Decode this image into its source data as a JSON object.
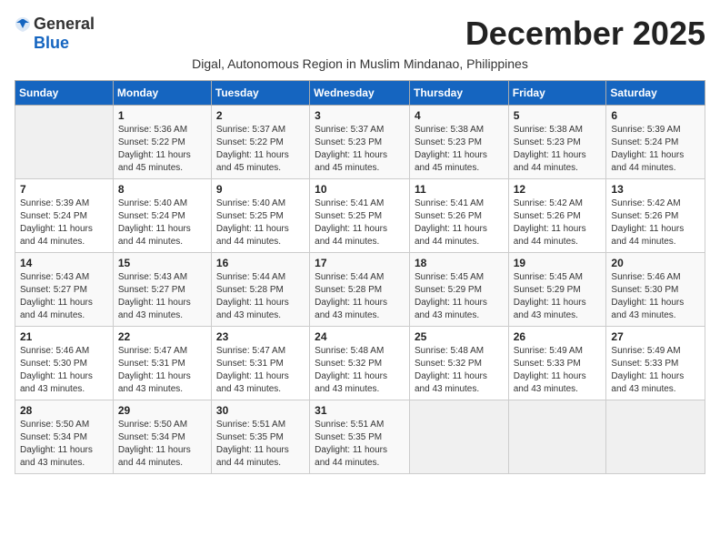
{
  "header": {
    "logo_line1": "General",
    "logo_line2": "Blue",
    "month_year": "December 2025",
    "subtitle": "Digal, Autonomous Region in Muslim Mindanao, Philippines"
  },
  "columns": [
    "Sunday",
    "Monday",
    "Tuesday",
    "Wednesday",
    "Thursday",
    "Friday",
    "Saturday"
  ],
  "weeks": [
    [
      {
        "day": "",
        "info": ""
      },
      {
        "day": "1",
        "info": "Sunrise: 5:36 AM\nSunset: 5:22 PM\nDaylight: 11 hours\nand 45 minutes."
      },
      {
        "day": "2",
        "info": "Sunrise: 5:37 AM\nSunset: 5:22 PM\nDaylight: 11 hours\nand 45 minutes."
      },
      {
        "day": "3",
        "info": "Sunrise: 5:37 AM\nSunset: 5:23 PM\nDaylight: 11 hours\nand 45 minutes."
      },
      {
        "day": "4",
        "info": "Sunrise: 5:38 AM\nSunset: 5:23 PM\nDaylight: 11 hours\nand 45 minutes."
      },
      {
        "day": "5",
        "info": "Sunrise: 5:38 AM\nSunset: 5:23 PM\nDaylight: 11 hours\nand 44 minutes."
      },
      {
        "day": "6",
        "info": "Sunrise: 5:39 AM\nSunset: 5:24 PM\nDaylight: 11 hours\nand 44 minutes."
      }
    ],
    [
      {
        "day": "7",
        "info": "Sunrise: 5:39 AM\nSunset: 5:24 PM\nDaylight: 11 hours\nand 44 minutes."
      },
      {
        "day": "8",
        "info": "Sunrise: 5:40 AM\nSunset: 5:24 PM\nDaylight: 11 hours\nand 44 minutes."
      },
      {
        "day": "9",
        "info": "Sunrise: 5:40 AM\nSunset: 5:25 PM\nDaylight: 11 hours\nand 44 minutes."
      },
      {
        "day": "10",
        "info": "Sunrise: 5:41 AM\nSunset: 5:25 PM\nDaylight: 11 hours\nand 44 minutes."
      },
      {
        "day": "11",
        "info": "Sunrise: 5:41 AM\nSunset: 5:26 PM\nDaylight: 11 hours\nand 44 minutes."
      },
      {
        "day": "12",
        "info": "Sunrise: 5:42 AM\nSunset: 5:26 PM\nDaylight: 11 hours\nand 44 minutes."
      },
      {
        "day": "13",
        "info": "Sunrise: 5:42 AM\nSunset: 5:26 PM\nDaylight: 11 hours\nand 44 minutes."
      }
    ],
    [
      {
        "day": "14",
        "info": "Sunrise: 5:43 AM\nSunset: 5:27 PM\nDaylight: 11 hours\nand 44 minutes."
      },
      {
        "day": "15",
        "info": "Sunrise: 5:43 AM\nSunset: 5:27 PM\nDaylight: 11 hours\nand 43 minutes."
      },
      {
        "day": "16",
        "info": "Sunrise: 5:44 AM\nSunset: 5:28 PM\nDaylight: 11 hours\nand 43 minutes."
      },
      {
        "day": "17",
        "info": "Sunrise: 5:44 AM\nSunset: 5:28 PM\nDaylight: 11 hours\nand 43 minutes."
      },
      {
        "day": "18",
        "info": "Sunrise: 5:45 AM\nSunset: 5:29 PM\nDaylight: 11 hours\nand 43 minutes."
      },
      {
        "day": "19",
        "info": "Sunrise: 5:45 AM\nSunset: 5:29 PM\nDaylight: 11 hours\nand 43 minutes."
      },
      {
        "day": "20",
        "info": "Sunrise: 5:46 AM\nSunset: 5:30 PM\nDaylight: 11 hours\nand 43 minutes."
      }
    ],
    [
      {
        "day": "21",
        "info": "Sunrise: 5:46 AM\nSunset: 5:30 PM\nDaylight: 11 hours\nand 43 minutes."
      },
      {
        "day": "22",
        "info": "Sunrise: 5:47 AM\nSunset: 5:31 PM\nDaylight: 11 hours\nand 43 minutes."
      },
      {
        "day": "23",
        "info": "Sunrise: 5:47 AM\nSunset: 5:31 PM\nDaylight: 11 hours\nand 43 minutes."
      },
      {
        "day": "24",
        "info": "Sunrise: 5:48 AM\nSunset: 5:32 PM\nDaylight: 11 hours\nand 43 minutes."
      },
      {
        "day": "25",
        "info": "Sunrise: 5:48 AM\nSunset: 5:32 PM\nDaylight: 11 hours\nand 43 minutes."
      },
      {
        "day": "26",
        "info": "Sunrise: 5:49 AM\nSunset: 5:33 PM\nDaylight: 11 hours\nand 43 minutes."
      },
      {
        "day": "27",
        "info": "Sunrise: 5:49 AM\nSunset: 5:33 PM\nDaylight: 11 hours\nand 43 minutes."
      }
    ],
    [
      {
        "day": "28",
        "info": "Sunrise: 5:50 AM\nSunset: 5:34 PM\nDaylight: 11 hours\nand 43 minutes."
      },
      {
        "day": "29",
        "info": "Sunrise: 5:50 AM\nSunset: 5:34 PM\nDaylight: 11 hours\nand 44 minutes."
      },
      {
        "day": "30",
        "info": "Sunrise: 5:51 AM\nSunset: 5:35 PM\nDaylight: 11 hours\nand 44 minutes."
      },
      {
        "day": "31",
        "info": "Sunrise: 5:51 AM\nSunset: 5:35 PM\nDaylight: 11 hours\nand 44 minutes."
      },
      {
        "day": "",
        "info": ""
      },
      {
        "day": "",
        "info": ""
      },
      {
        "day": "",
        "info": ""
      }
    ]
  ]
}
